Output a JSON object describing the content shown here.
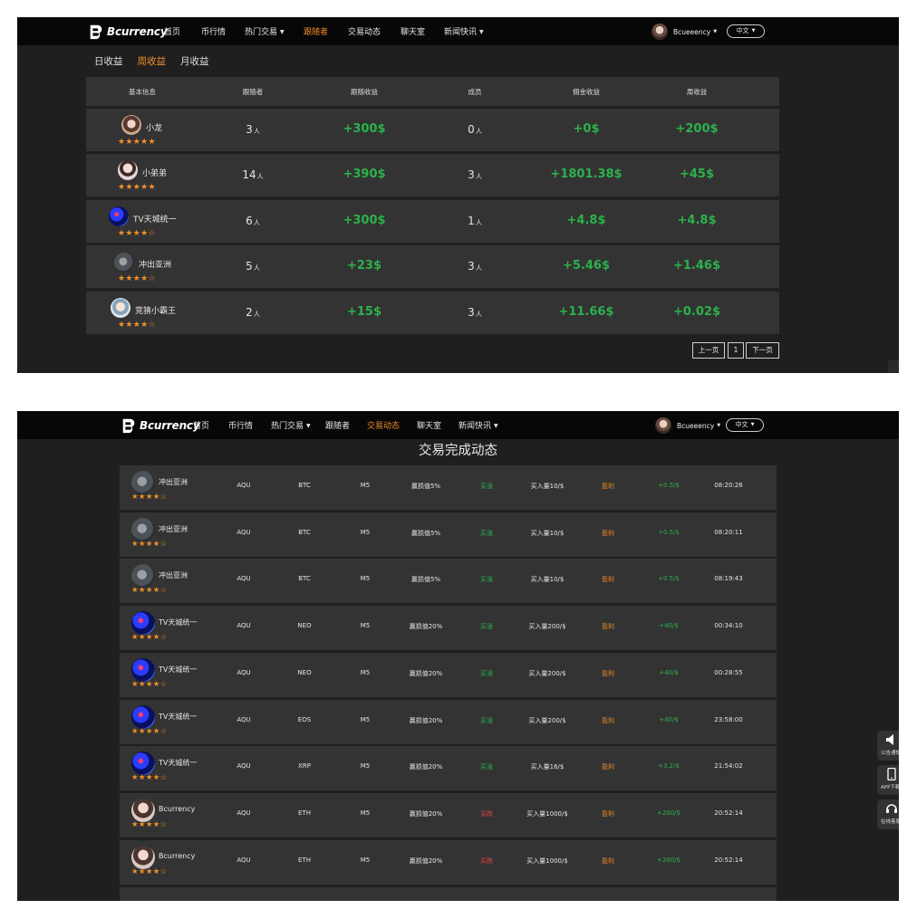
{
  "brand": {
    "name": "Bcurrency"
  },
  "nav": {
    "home": "首页",
    "market": "币行情",
    "hot_trade": "热门交易",
    "followers": "跟随者",
    "trade_feed": "交易动态",
    "chat": "聊天室",
    "news": "新闻快讯"
  },
  "user": {
    "name_top": "Bcueeency",
    "name_bottom": "Bcueeency"
  },
  "lang": {
    "label": "中文"
  },
  "earnings": {
    "tabs": [
      "日收益",
      "周收益",
      "月收益"
    ],
    "headers": [
      "基本信息",
      "跟随者",
      "跟随收益",
      "成员",
      "佣金收益",
      "周收益"
    ],
    "unit": "人",
    "rows": [
      {
        "name": "小龙",
        "rating": 5,
        "followers": "3",
        "follow_income": "+300$",
        "members": "0",
        "commission": "+0$",
        "weekly": "+200$"
      },
      {
        "name": "小弟弟",
        "rating": 5,
        "followers": "14",
        "follow_income": "+390$",
        "members": "3",
        "commission": "+1801.38$",
        "weekly": "+45$"
      },
      {
        "name": "TV天城统一",
        "rating": 4,
        "followers": "6",
        "follow_income": "+300$",
        "members": "1",
        "commission": "+4.8$",
        "weekly": "+4.8$"
      },
      {
        "name": "冲出亚洲",
        "rating": 4,
        "followers": "5",
        "follow_income": "+23$",
        "members": "3",
        "commission": "+5.46$",
        "weekly": "+1.46$"
      },
      {
        "name": "竞猜小霸王",
        "rating": 4,
        "followers": "2",
        "follow_income": "+15$",
        "members": "3",
        "commission": "+11.66$",
        "weekly": "+0.02$"
      }
    ],
    "pager": {
      "prev": "上一页",
      "page": "1",
      "next": "下一页"
    }
  },
  "feed": {
    "title": "交易完成动态",
    "rows": [
      {
        "name": "冲出亚洲",
        "rating": 4,
        "platform": "AQU",
        "coin": "BTC",
        "period": "M5",
        "stop": "赢损值5%",
        "direction": "买涨",
        "dir_color": "#2bb24c",
        "amount": "买入量10/$",
        "result": "盈利",
        "profit": "+0.5/$",
        "time": "08:20:26"
      },
      {
        "name": "冲出亚洲",
        "rating": 4,
        "platform": "AQU",
        "coin": "BTC",
        "period": "M5",
        "stop": "赢损值5%",
        "direction": "买涨",
        "dir_color": "#2bb24c",
        "amount": "买入量10/$",
        "result": "盈利",
        "profit": "+0.5/$",
        "time": "08:20:11"
      },
      {
        "name": "冲出亚洲",
        "rating": 4,
        "platform": "AQU",
        "coin": "BTC",
        "period": "M5",
        "stop": "赢损值5%",
        "direction": "买涨",
        "dir_color": "#2bb24c",
        "amount": "买入量10/$",
        "result": "盈利",
        "profit": "+0.5/$",
        "time": "08:19:43"
      },
      {
        "name": "TV天城统一",
        "rating": 4,
        "platform": "AQU",
        "coin": "NEO",
        "period": "M5",
        "stop": "赢损值20%",
        "direction": "买涨",
        "dir_color": "#2bb24c",
        "amount": "买入量200/$",
        "result": "盈利",
        "profit": "+40/$",
        "time": "00:34:10"
      },
      {
        "name": "TV天城统一",
        "rating": 4,
        "platform": "AQU",
        "coin": "NEO",
        "period": "M5",
        "stop": "赢损值20%",
        "direction": "买涨",
        "dir_color": "#2bb24c",
        "amount": "买入量200/$",
        "result": "盈利",
        "profit": "+40/$",
        "time": "00:28:55"
      },
      {
        "name": "TV天城统一",
        "rating": 4,
        "platform": "AQU",
        "coin": "EOS",
        "period": "M5",
        "stop": "赢损值20%",
        "direction": "买涨",
        "dir_color": "#2bb24c",
        "amount": "买入量200/$",
        "result": "盈利",
        "profit": "+40/$",
        "time": "23:58:00"
      },
      {
        "name": "TV天城统一",
        "rating": 4,
        "platform": "AQU",
        "coin": "XRP",
        "period": "M5",
        "stop": "赢损值20%",
        "direction": "买涨",
        "dir_color": "#2bb24c",
        "amount": "买入量16/$",
        "result": "盈利",
        "profit": "+3.2/$",
        "time": "21:54:02"
      },
      {
        "name": "Bcurrency",
        "rating": 4,
        "platform": "AQU",
        "coin": "ETH",
        "period": "M5",
        "stop": "赢损值20%",
        "direction": "买跌",
        "dir_color": "#e04545",
        "amount": "买入量1000/$",
        "result": "盈利",
        "profit": "+200/$",
        "time": "20:52:14"
      },
      {
        "name": "Bcurrency",
        "rating": 4,
        "platform": "AQU",
        "coin": "ETH",
        "period": "M5",
        "stop": "赢损值20%",
        "direction": "买跌",
        "dir_color": "#e04545",
        "amount": "买入量1000/$",
        "result": "盈利",
        "profit": "+200/$",
        "time": "20:52:14"
      }
    ]
  },
  "side_widgets": [
    {
      "label": "公告通知",
      "icon": "speaker-icon"
    },
    {
      "label": "APP下载",
      "icon": "phone-icon"
    },
    {
      "label": "在线客服",
      "icon": "headset-icon"
    }
  ],
  "colors": {
    "accent": "#f08a28",
    "profit_green": "#2bb24c",
    "loss_red": "#e04545",
    "star": "#f3902a",
    "bg": "#1f1f1f",
    "row": "#333333"
  }
}
